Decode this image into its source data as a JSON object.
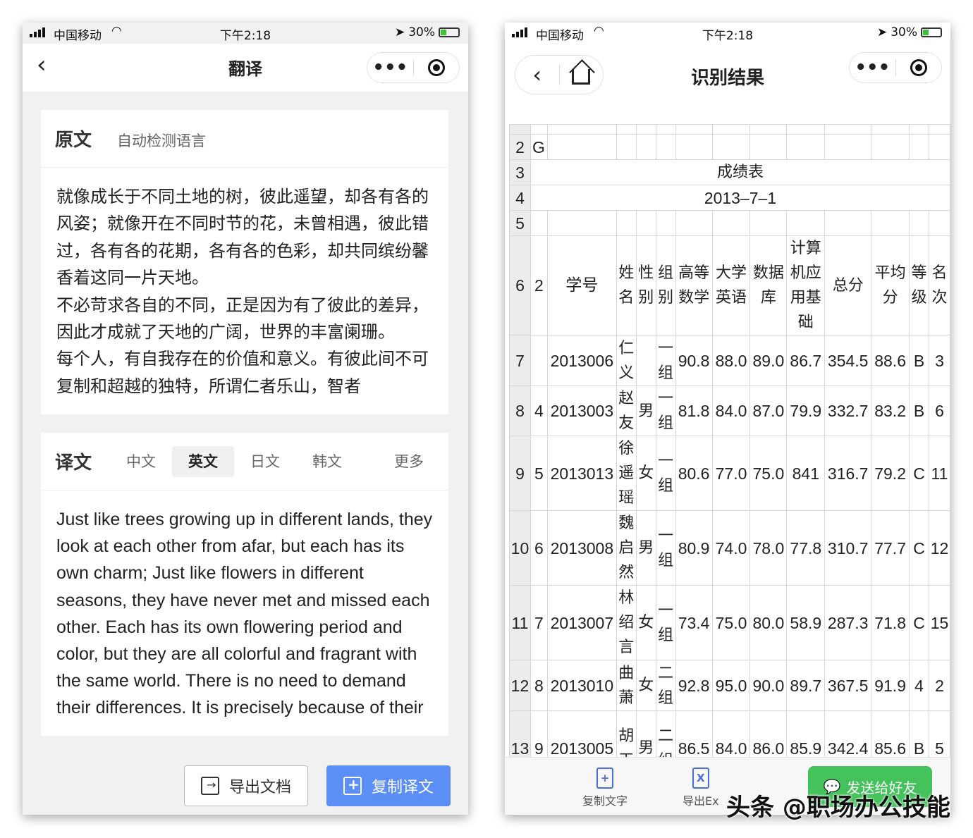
{
  "status": {
    "carrier": "中国移动",
    "time": "下午2:18",
    "battery": "30%"
  },
  "left": {
    "nav_title": "翻译",
    "source": {
      "label": "原文",
      "detect": "自动检测语言",
      "text": "就像成长于不同土地的树，彼此遥望，却各有各的风姿；就像开在不同时节的花，未曾相遇，彼此错过，各有各的花期，各有各的色彩，却共同缤纷馨香着这同一片天地。\n不必苛求各自的不同，正是因为有了彼此的差异，因此才成就了天地的广阔，世界的丰富阑珊。\n每个人，有自我存在的价值和意义。有彼此间不可复制和超越的独特，所谓仁者乐山，智者"
    },
    "target": {
      "label": "译文",
      "langs": [
        "中文",
        "英文",
        "日文",
        "韩文"
      ],
      "more": "更多",
      "text": "Just like trees growing up in different lands, they look at each other from afar, but each has its own charm; Just like flowers in different seasons, they have never met and missed each other. Each has its own flowering period and color, but they are all colorful and fragrant with the same world. There is no need to demand their differences. It is precisely because of their"
    },
    "buttons": {
      "export": "导出文档",
      "copy": "复制译文"
    }
  },
  "right": {
    "nav_title": "识别结果",
    "sheet": {
      "row2": [
        "2",
        "G"
      ],
      "row3": [
        "3",
        "成绩表"
      ],
      "row4": [
        "4",
        "2013–7–1"
      ],
      "row5": [
        "5"
      ],
      "header": [
        "6",
        "2",
        "学号",
        "姓名",
        "性别",
        "组别",
        "高等数学",
        "大学英语",
        "数据库",
        "计算机应用基础",
        "总分",
        "平均分",
        "等级",
        "名次"
      ],
      "rows": [
        [
          "7",
          "",
          "2013006",
          "仁义",
          "",
          "一组",
          "90.8",
          "88.0",
          "89.0",
          "86.7",
          "354.5",
          "88.6",
          "B",
          "3"
        ],
        [
          "8",
          "4",
          "2013003",
          "赵友",
          "男",
          "一组",
          "81.8",
          "84.0",
          "87.0",
          "79.9",
          "332.7",
          "83.2",
          "B",
          "6"
        ],
        [
          "9",
          "5",
          "2013013",
          "徐遥瑶",
          "女",
          "一组",
          "80.6",
          "77.0",
          "75.0",
          "841",
          "316.7",
          "79.2",
          "C",
          "11"
        ],
        [
          "10",
          "6",
          "2013008",
          "魏启然",
          "男",
          "一组",
          "80.9",
          "74.0",
          "78.0",
          "77.8",
          "310.7",
          "77.7",
          "C",
          "12"
        ],
        [
          "11",
          "7",
          "2013007",
          "林绍言",
          "女",
          "一组",
          "73.4",
          "75.0",
          "80.0",
          "58.9",
          "287.3",
          "71.8",
          "C",
          "15"
        ],
        [
          "12",
          "8",
          "2013010",
          "曲萧",
          "女",
          "二组",
          "92.8",
          "95.0",
          "90.0",
          "89.7",
          "367.5",
          "91.9",
          "4",
          "2"
        ],
        [
          "13",
          "9",
          "2013005",
          "胡天",
          "男",
          "二组",
          "86.5",
          "84.0",
          "86.0",
          "85.9",
          "342.4",
          "85.6",
          "B",
          "5"
        ]
      ]
    },
    "bottom": {
      "copy_text": "复制文字",
      "export_excel": "导出Ex",
      "send": "发送给好友"
    }
  },
  "watermark": "头条 @职场办公技能"
}
